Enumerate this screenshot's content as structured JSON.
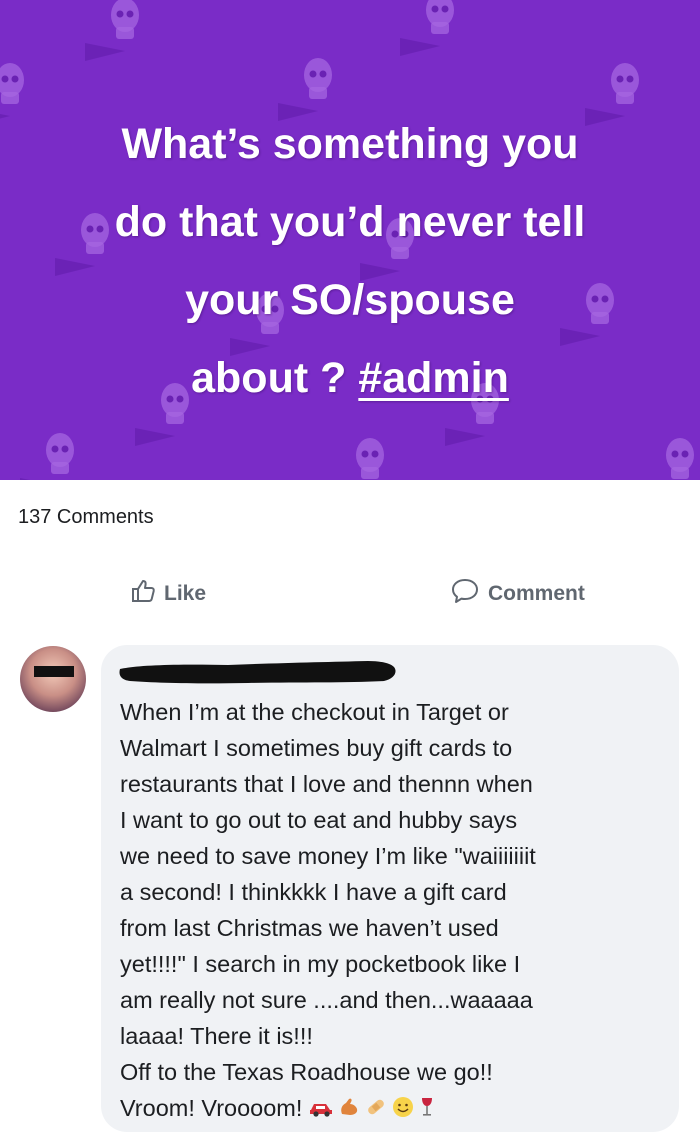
{
  "post": {
    "question_line1": "What’s something you",
    "question_line2": "do that you’d never tell",
    "question_line3": "your SO/spouse",
    "question_line4_prefix": "about ? ",
    "hashtag": "#admin",
    "background_color": "#7a2cc7",
    "pattern_icon": "skull-icon"
  },
  "comment_count": "137 Comments",
  "actions": {
    "like_label": "Like",
    "comment_label": "Comment"
  },
  "comment": {
    "author_name": "",
    "text": "When I’m at the checkout in Target or\nWalmart I sometimes buy gift cards to\nrestaurants that I love and thennn when\nI want to go out to eat and hubby says\nwe need to save money I’m like \"waiiiiiiit\na second! I thinkkkk I have a gift card\nfrom last Christmas we haven’t used\nyet!!!!\" I search in my pocketbook like I\nam really not sure ....and then...waaaaa\nlaaaa! There it is!!!\nOff to the Texas Roadhouse we go!!\nVroom!  Vroooom!",
    "emojis": [
      "car-icon",
      "flexed-arm-icon",
      "bandage-icon",
      "smiley-icon",
      "wine-glass-icon"
    ],
    "bubble_color": "#f0f2f5"
  }
}
